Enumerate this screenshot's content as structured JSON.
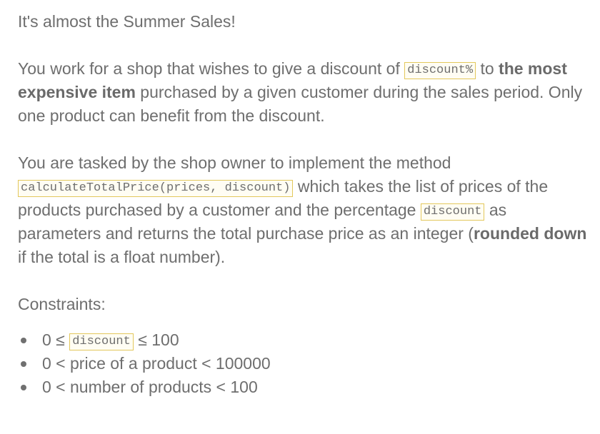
{
  "title": "It's almost the Summer Sales!",
  "paragraph1": {
    "part1": "You work for a shop that wishes to give a discount of ",
    "code1": "discount%",
    "part2": " to ",
    "bold1": "the most expensive item",
    "part3": " purchased by a given customer during the sales period. Only one product can benefit from the discount."
  },
  "paragraph2": {
    "part1": "You are tasked by the shop owner to implement the method ",
    "code1": "calculateTotalPrice(prices, discount)",
    "part2": " which takes the list of prices of the products purchased by a customer and the percentage ",
    "code2": "discount",
    "part3": " as parameters and returns the total purchase price as an integer (",
    "bold1": "rounded down",
    "part4": " if the total is a float number)."
  },
  "constraints": {
    "heading": "Constraints:",
    "item1": {
      "before": "0 ≤ ",
      "code": "discount",
      "after": " ≤ 100"
    },
    "item2": "0 < price of a product < 100000",
    "item3": "0 < number of products < 100"
  }
}
